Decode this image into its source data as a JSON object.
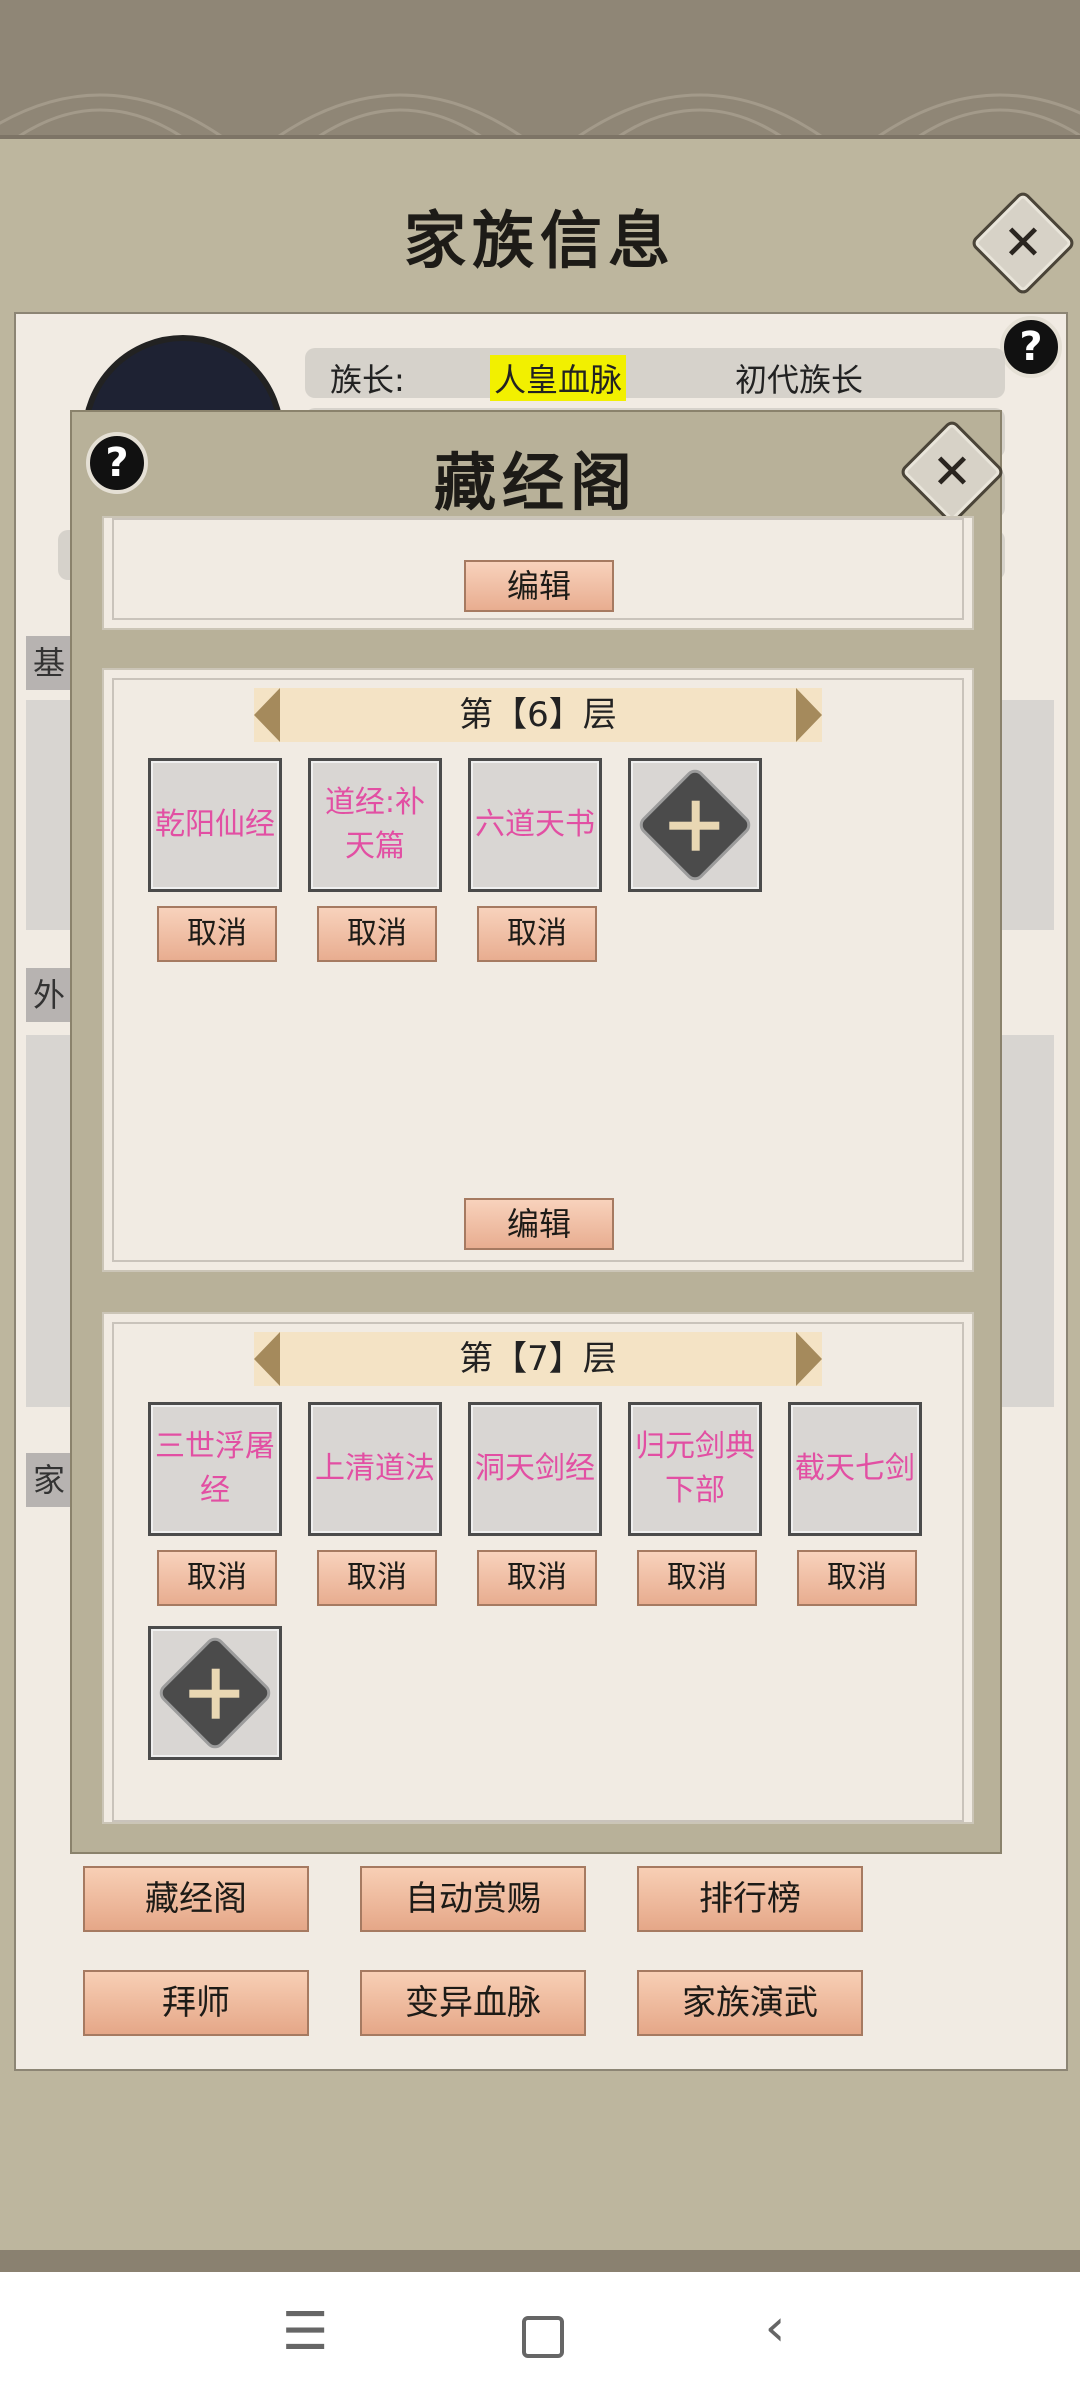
{
  "background": {
    "title": "家族信息",
    "leader_label": "族长:",
    "bloodline": "人皇血脉",
    "leader_title": "初代族长",
    "section_tabs": [
      "基",
      "外",
      "家"
    ],
    "buttons_row1": [
      "藏经阁",
      "自动赏赐",
      "排行榜"
    ],
    "buttons_row2": [
      "拜师",
      "变异血脉",
      "家族演武"
    ]
  },
  "modal": {
    "title": "藏经阁",
    "edit_label": "编辑",
    "cancel_label": "取消",
    "floors": [
      {
        "title": "第【6】层",
        "books": [
          "乾阳仙经",
          "道经:补天篇",
          "六道天书"
        ]
      },
      {
        "title": "第【7】层",
        "books": [
          "三世浮屠经",
          "上清道法",
          "洞天剑经",
          "归元剑典下部",
          "截天七剑"
        ]
      }
    ]
  },
  "icons": {
    "help": "help-icon",
    "close": "close-icon",
    "add": "add-slot-icon",
    "nav": [
      "menu-icon",
      "home-icon",
      "back-icon"
    ]
  },
  "colors": {
    "book_text": "#e24fa3",
    "bloodline_highlight": "#f2f000"
  }
}
